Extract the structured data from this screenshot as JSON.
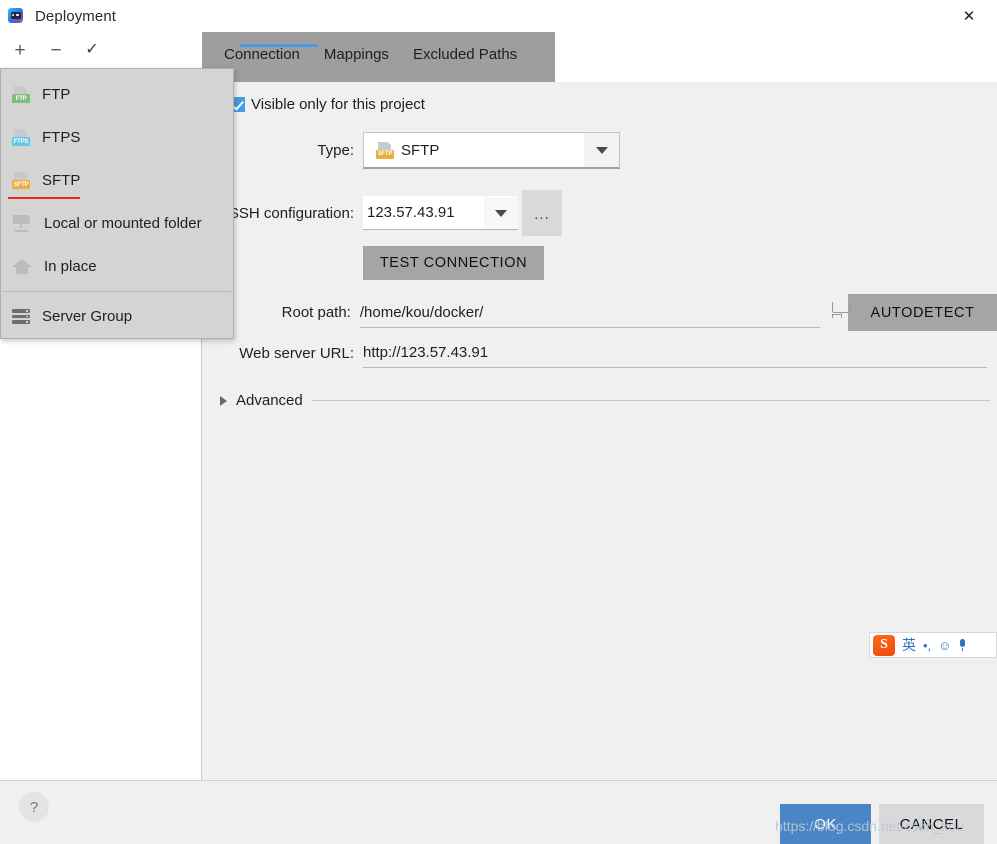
{
  "window": {
    "title": "Deployment",
    "icon": "deployment-icon",
    "close_label": "✕"
  },
  "toolbar": {
    "add_label": "+",
    "remove_label": "−",
    "apply_label": "✓"
  },
  "tabs": [
    {
      "label": "Connection",
      "active": true
    },
    {
      "label": "Mappings",
      "active": false
    },
    {
      "label": "Excluded Paths",
      "active": false
    }
  ],
  "dropdown": {
    "items": [
      {
        "label": "FTP",
        "icon": "ftp-icon",
        "tag": "FTP",
        "selected": false
      },
      {
        "label": "FTPS",
        "icon": "ftps-icon",
        "tag": "FTPS",
        "selected": false
      },
      {
        "label": "SFTP",
        "icon": "sftp-icon",
        "tag": "SFTP",
        "selected": true
      },
      {
        "label": "Local or mounted folder",
        "icon": "local-folder-icon",
        "selected": false
      },
      {
        "label": "In place",
        "icon": "home-icon",
        "selected": false
      },
      {
        "label": "Server Group",
        "icon": "server-group-icon",
        "selected": false
      }
    ]
  },
  "form": {
    "visible_only_label": "Visible only for this project",
    "visible_only_checked": true,
    "type_label": "Type:",
    "type_value": "SFTP",
    "type_icon_tag": "SFTP",
    "ssh_label": "SSH configuration:",
    "ssh_value": "123.57.43.91",
    "browse_label": "...",
    "test_connection_label": "TEST CONNECTION",
    "root_path_label": "Root path:",
    "root_path_value": "/home/kou/docker/",
    "autodetect_label": "AUTODETECT",
    "web_server_label": "Web server URL:",
    "web_server_value": "http://123.57.43.91",
    "advanced_label": "Advanced"
  },
  "footer": {
    "help_label": "?",
    "ok_label": "OK",
    "cancel_label": "CANCEL"
  },
  "watermark": {
    "text": "https://blog.csdn.net/csdn_kou"
  },
  "ime": {
    "logo": "S",
    "lang": "英",
    "punctuation": "•,",
    "emoji": "☺",
    "mic": "mic-icon"
  },
  "colors": {
    "accent_blue": "#4a9ae8",
    "ok_button": "#4a86c5",
    "tab_strip": "#9e9e9e",
    "panel_bg": "#f0f0f0",
    "popup_bg": "#d4d4d4",
    "selected_underline": "#ee2222"
  }
}
